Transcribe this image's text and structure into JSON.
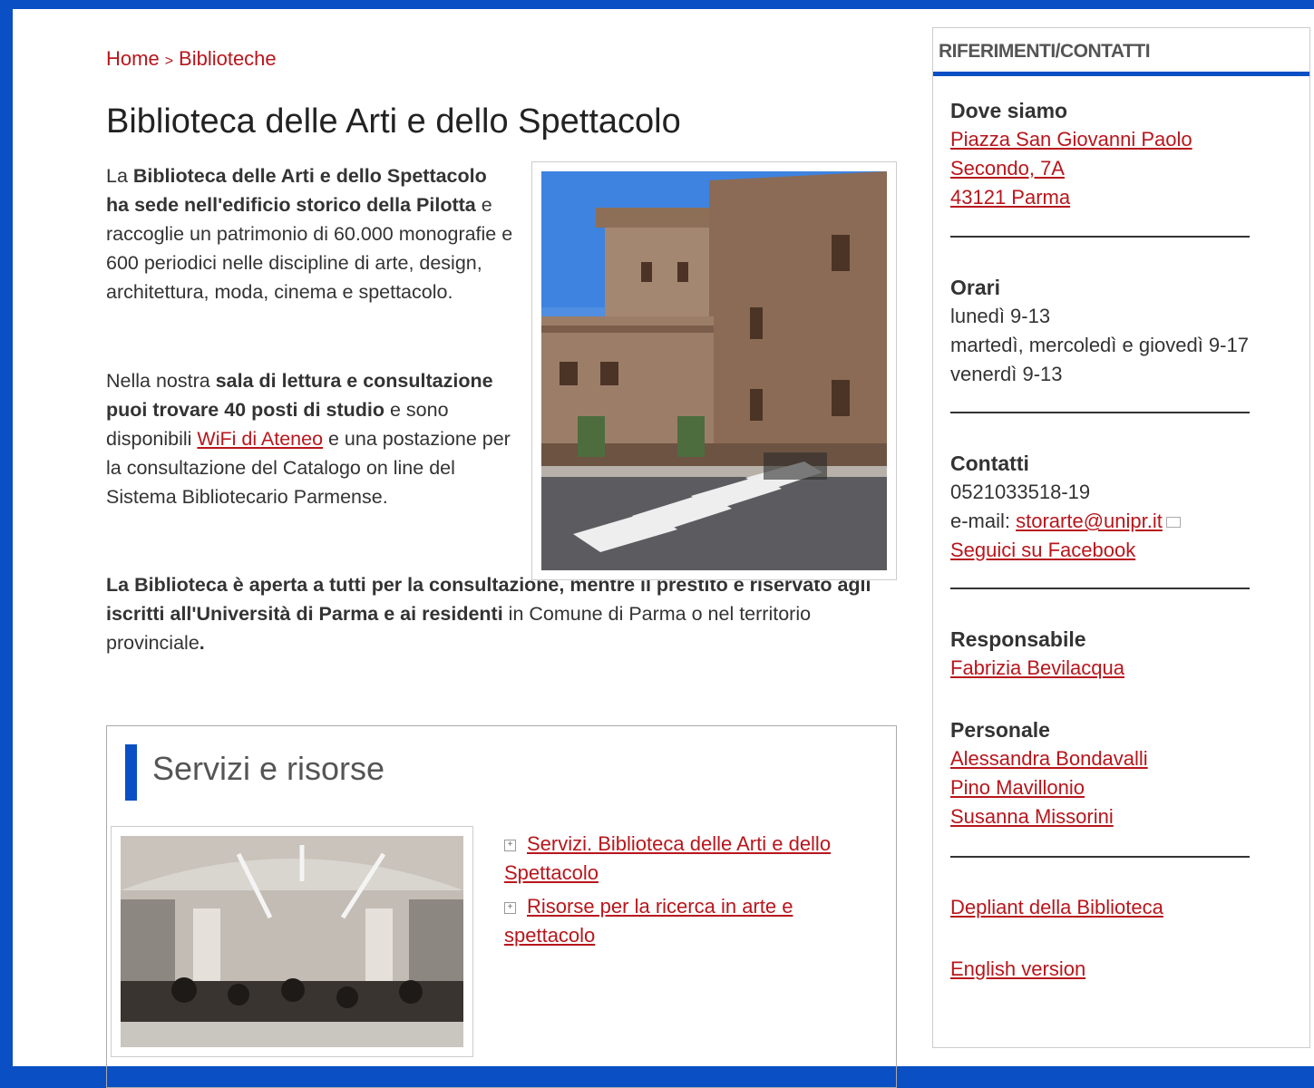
{
  "breadcrumb": {
    "home": "Home",
    "sep": ">",
    "current": "Biblioteche"
  },
  "title": "Biblioteca delle Arti e dello Spettacolo",
  "intro": {
    "p1_a": "La ",
    "p1_b": "Biblioteca delle Arti e dello Spettacolo ha sede nell'edificio storico della Pilotta",
    "p1_c": " e raccoglie un patrimonio di 60.000 monografie e 600 periodici nelle discipline di arte, design, architettura, moda, cinema e spettacolo.",
    "p2_a": "Nella nostra ",
    "p2_b": "sala di lettura e consultazione puoi trovare 40 posti di studio",
    "p2_c": " e sono disponibili ",
    "p2_link": "WiFi di Ateneo",
    "p2_d": " e una postazione per la consultazione del Catalogo on line del Sistema Bibliotecario Parmense.",
    "p3_a": "La Biblioteca è aperta a tutti per la consultazione, mentre il prestito è riservato agli iscritti all'Università di Parma e ai residenti",
    "p3_b": " in Comune di Parma o nel territorio provinciale",
    "p3_c": "."
  },
  "services": {
    "heading": "Servizi e risorse",
    "links": [
      "Servizi. Biblioteca delle Arti e dello Spettacolo",
      "Risorse per la ricerca in arte e spettacolo"
    ]
  },
  "sidebar": {
    "heading": "RIFERIMENTI/CONTATTI",
    "where": {
      "title": "Dove siamo",
      "address": [
        "Piazza San Giovanni Paolo",
        "Secondo, 7A",
        "43121 Parma"
      ]
    },
    "hours": {
      "title": "Orari",
      "lines": [
        "lunedì 9-13",
        "martedì, mercoledì e giovedì 9-17",
        "venerdì 9-13"
      ]
    },
    "contacts": {
      "title": "Contatti",
      "phone": "0521033518-19",
      "email_label": "e-mail: ",
      "email": "storarte@unipr.it",
      "facebook": "Seguici su Facebook"
    },
    "manager": {
      "title": "Responsabile",
      "name": "Fabrizia Bevilacqua"
    },
    "staff": {
      "title": "Personale",
      "names": [
        "Alessandra Bondavalli",
        "Pino Mavillonio",
        "Susanna Missorini"
      ]
    },
    "depliant": "Depliant della Biblioteca",
    "english": "English version"
  },
  "colors": {
    "frame": "#0a4fc4",
    "link": "#b8161c",
    "accent": "#0a4fc4"
  }
}
